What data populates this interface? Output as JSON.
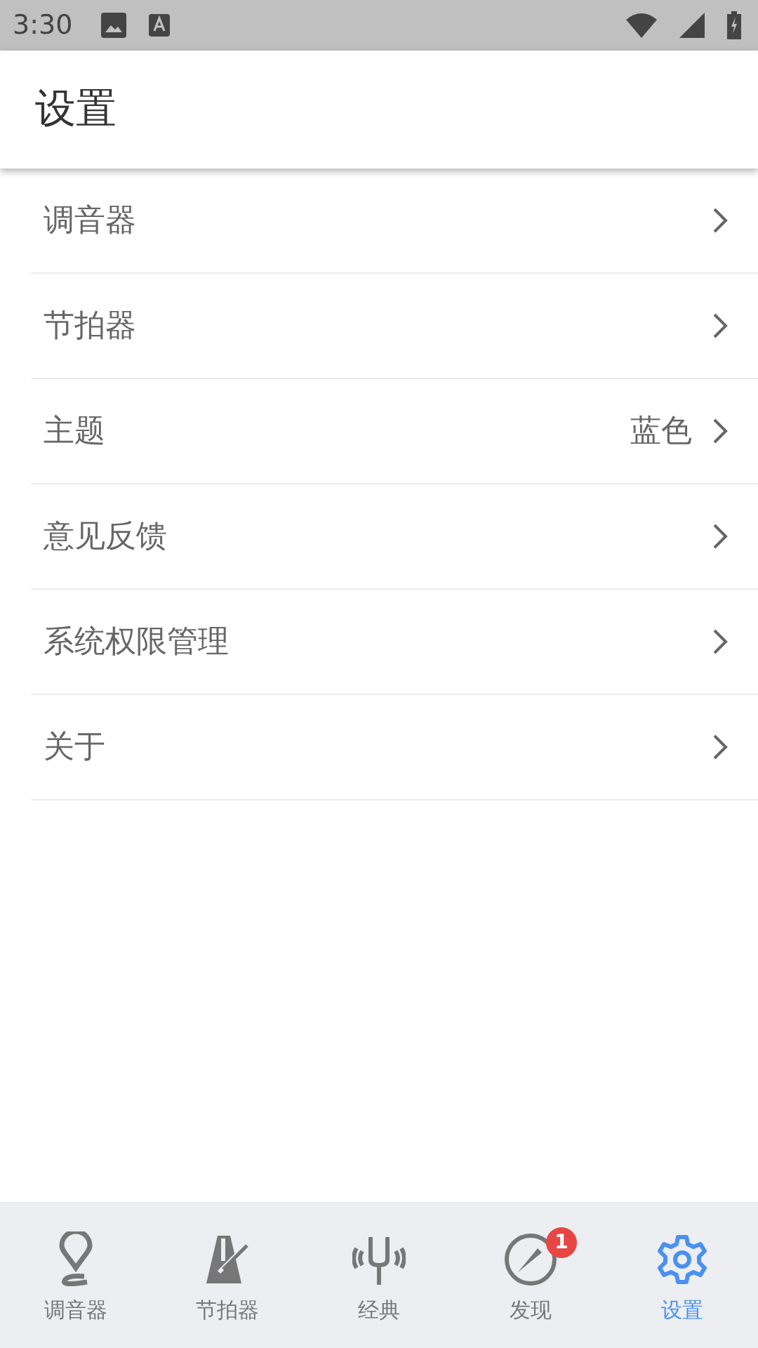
{
  "status_bar": {
    "time": "3:30"
  },
  "app_bar": {
    "title": "设置"
  },
  "settings": [
    {
      "label": "调音器"
    },
    {
      "label": "节拍器"
    },
    {
      "label": "主题",
      "value": "蓝色"
    },
    {
      "label": "意见反馈"
    },
    {
      "label": "系统权限管理"
    },
    {
      "label": "关于"
    }
  ],
  "bottom_nav": [
    {
      "kind": "tuner",
      "label": "调音器",
      "selected": false
    },
    {
      "kind": "metronome",
      "label": "节拍器",
      "selected": false
    },
    {
      "kind": "fork",
      "label": "经典",
      "selected": false
    },
    {
      "kind": "compass",
      "label": "发现",
      "selected": false,
      "badge": "1"
    },
    {
      "kind": "gear",
      "label": "设置",
      "selected": true
    }
  ]
}
